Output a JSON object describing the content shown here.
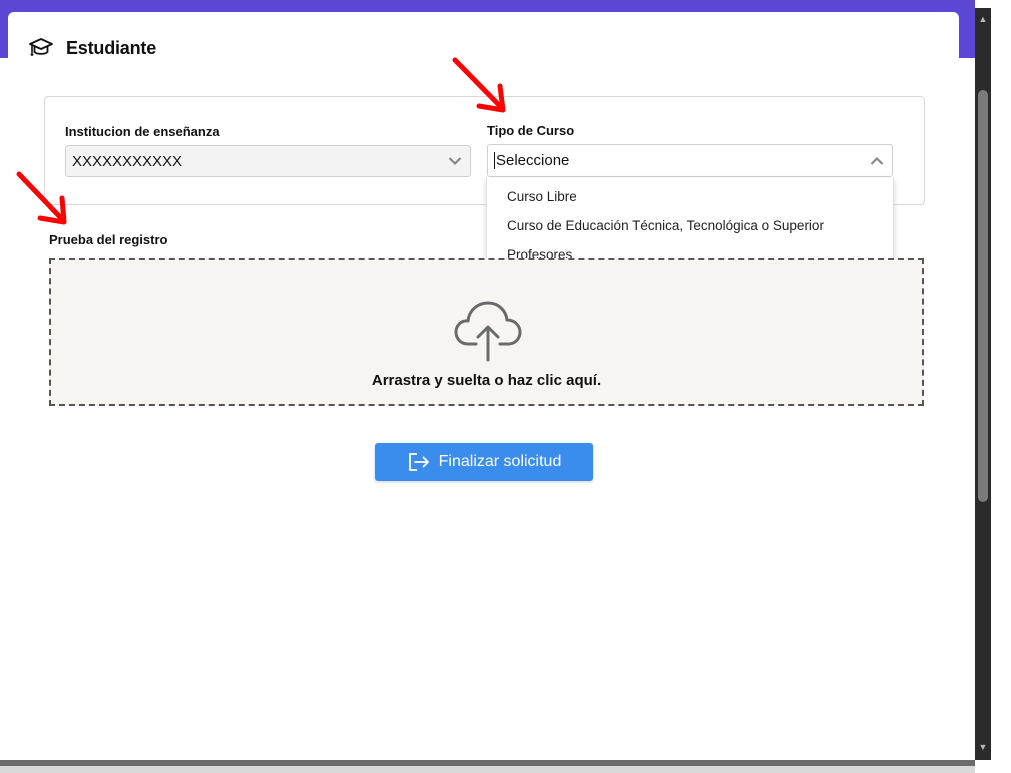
{
  "modal": {
    "title": "Estudiante",
    "icon": "graduation-cap-icon"
  },
  "form": {
    "institution": {
      "label": "Institucion de enseñanza",
      "value": "XXXXXXXXXXX"
    },
    "course_type": {
      "label": "Tipo de Curso",
      "value": "Seleccione",
      "options": [
        "Curso Libre",
        "Curso de Educación Técnica, Tecnológica o Superior",
        "Profesores"
      ]
    }
  },
  "upload": {
    "label": "Prueba del registro",
    "hint": "Arrastra y suelta o haz clic aquí.",
    "icon": "cloud-upload-icon"
  },
  "actions": {
    "finish_label": "Finalizar solicitud",
    "finish_icon": "exit-icon"
  },
  "colors": {
    "accent": "#5b46d6",
    "button": "#3b8ded",
    "annotation": "#ff0000"
  }
}
